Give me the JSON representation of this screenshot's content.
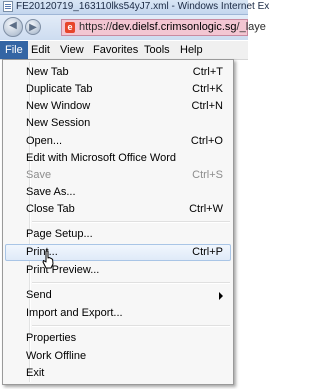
{
  "window": {
    "title": "FE20120719_163110lks54yJ7.xml - Windows Internet Ex"
  },
  "address": {
    "prefix": "https://",
    "host": "dev.dielsf.crimsonlogic.sg",
    "path": "/_laye"
  },
  "menubar": {
    "items": [
      "File",
      "Edit",
      "View",
      "Favorites",
      "Tools",
      "Help"
    ],
    "active": "File"
  },
  "file_menu": {
    "items": [
      {
        "label": "New Tab",
        "shortcut": "Ctrl+T"
      },
      {
        "label": "Duplicate Tab",
        "shortcut": "Ctrl+K"
      },
      {
        "label": "New Window",
        "shortcut": "Ctrl+N"
      },
      {
        "label": "New Session",
        "shortcut": ""
      },
      {
        "label": "Open...",
        "shortcut": "Ctrl+O"
      },
      {
        "label": "Edit with Microsoft Office Word",
        "shortcut": ""
      },
      {
        "label": "Save",
        "shortcut": "Ctrl+S",
        "disabled": true
      },
      {
        "label": "Save As...",
        "shortcut": ""
      },
      {
        "label": "Close Tab",
        "shortcut": "Ctrl+W"
      },
      {
        "label": "Page Setup...",
        "shortcut": ""
      },
      {
        "label": "Print...",
        "shortcut": "Ctrl+P",
        "hovered": true
      },
      {
        "label": "Print Preview...",
        "shortcut": ""
      },
      {
        "label": "Send",
        "shortcut": ""
      },
      {
        "label": "Import and Export...",
        "shortcut": ""
      },
      {
        "label": "Properties",
        "shortcut": ""
      },
      {
        "label": "Work Offline",
        "shortcut": ""
      },
      {
        "label": "Exit",
        "shortcut": ""
      }
    ]
  }
}
